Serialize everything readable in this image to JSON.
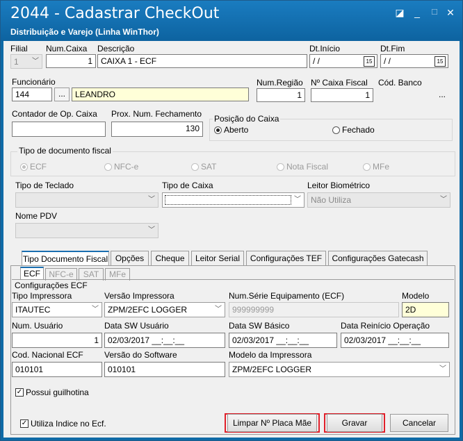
{
  "window": {
    "title": "2044 - Cadastrar CheckOut",
    "subtitle": "Distribuição e Varejo (Linha WinThor)"
  },
  "header": {
    "filial_label": "Filial",
    "filial_value": "1",
    "num_caixa_label": "Num.Caixa",
    "num_caixa_value": "1",
    "descricao_label": "Descrição",
    "descricao_value": "CAIXA 1 - ECF",
    "dt_inicio_label": "Dt.Início",
    "dt_inicio_value": " / /",
    "dt_fim_label": "Dt.Fim",
    "dt_fim_value": " / /",
    "cal_glyph": "15",
    "funcionario_label": "Funcionário",
    "funcionario_code": "144",
    "funcionario_name": "LEANDRO",
    "ellipsis": "...",
    "num_regiao_label": "Num.Região",
    "num_regiao_value": "1",
    "caixa_fiscal_label": "Nº Caixa Fiscal",
    "caixa_fiscal_value": "1",
    "cod_banco_label": "Cód. Banco",
    "contador_label": "Contador de Op. Caixa",
    "contador_value": "",
    "prox_num_label": "Prox. Num. Fechamento",
    "prox_num_value": "130",
    "posicao_label": "Posição do Caixa",
    "aberto": "Aberto",
    "fechado": "Fechado"
  },
  "tipo_doc": {
    "label": "Tipo de documento fiscal",
    "options": [
      "ECF",
      "NFC-e",
      "SAT",
      "Nota Fiscal",
      "MFe"
    ]
  },
  "fields2": {
    "teclado_label": "Tipo de Teclado",
    "teclado_value": "",
    "tipo_caixa_label": "Tipo de Caixa",
    "tipo_caixa_value": "",
    "leitor_label": "Leitor Biométrico",
    "leitor_value": "Não Utiliza",
    "nome_pdv_label": "Nome PDV",
    "nome_pdv_value": ""
  },
  "tabs": [
    "Tipo Documento Fiscal",
    "Opções",
    "Cheque",
    "Leitor Serial",
    "Configurações TEF",
    "Configurações Gatecash"
  ],
  "subtabs": [
    "ECF",
    "NFC-e",
    "SAT",
    "MFe"
  ],
  "ecf": {
    "group_label": "Configurações ECF",
    "tipo_impressora_label": "Tipo Impressora",
    "tipo_impressora_value": "ITAUTEC",
    "versao_impressora_label": "Versão Impressora",
    "versao_impressora_value": "ZPM/2EFC LOGGER",
    "num_serie_label": "Num.Série Equipamento (ECF)",
    "num_serie_value": "999999999",
    "modelo_label": "Modelo",
    "modelo_value": "2D",
    "num_usuario_label": "Num. Usuário",
    "num_usuario_value": "1",
    "data_sw_usuario_label": "Data SW Usuário",
    "data_sw_usuario_value": "02/03/2017 __:__:__",
    "data_sw_basico_label": "Data SW Básico",
    "data_sw_basico_value": "02/03/2017 __:__:__",
    "data_reinicio_label": "Data Reinício Operação",
    "data_reinicio_value": "02/03/2017 __:__:__",
    "cod_nacional_label": "Cod. Nacional ECF",
    "cod_nacional_value": "010101",
    "versao_software_label": "Versão do Software",
    "versao_software_value": "010101",
    "modelo_impressora_label": "Modelo da Impressora",
    "modelo_impressora_value": "ZPM/2EFC LOGGER",
    "guilhotina_label": "Possui guilhotina"
  },
  "footer": {
    "utiliza_indice_label": "Utiliza Indice no Ecf.",
    "limpar_label": "Limpar Nº Placa Mãe",
    "gravar_label": "Gravar",
    "cancelar_label": "Cancelar"
  },
  "colors": {
    "title_bar": "#0f6aa6",
    "highlight": "#e0202a",
    "required_field": "#ffffd8"
  }
}
